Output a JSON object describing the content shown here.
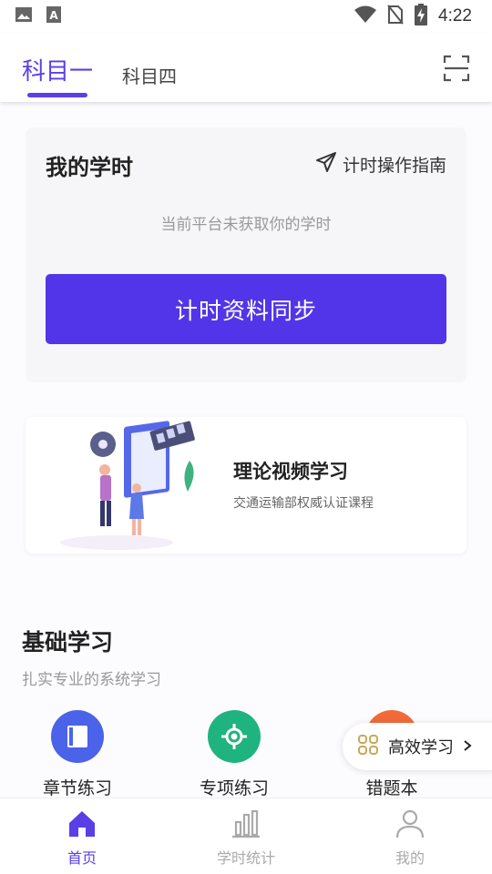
{
  "status_bar": {
    "time": "4:22"
  },
  "tabs": [
    {
      "label": "科目一",
      "active": true
    },
    {
      "label": "科目四",
      "active": false
    }
  ],
  "study_hours": {
    "title": "我的学时",
    "guide_label": "计时操作指南",
    "message": "当前平台未获取你的学时",
    "sync_button": "计时资料同步"
  },
  "video_card": {
    "title": "理论视频学习",
    "subtitle": "交通运输部权威认证课程"
  },
  "basic_section": {
    "title": "基础学习",
    "subtitle": "扎实专业的系统学习",
    "items": [
      {
        "label": "章节练习",
        "icon": "book-icon",
        "color": "#4a63e8"
      },
      {
        "label": "专项练习",
        "icon": "target-icon",
        "color": "#1fb380"
      },
      {
        "label": "错题本",
        "icon": "error-book-icon",
        "color": "#f26a3a"
      }
    ]
  },
  "floating_pill": {
    "label": "高效学习"
  },
  "bottom_nav": [
    {
      "label": "首页",
      "active": true
    },
    {
      "label": "学时统计",
      "active": false
    },
    {
      "label": "我的",
      "active": false
    }
  ],
  "colors": {
    "accent": "#5235e8",
    "active_nav": "#5b3fe6",
    "inactive_nav": "#aaaaaa"
  }
}
